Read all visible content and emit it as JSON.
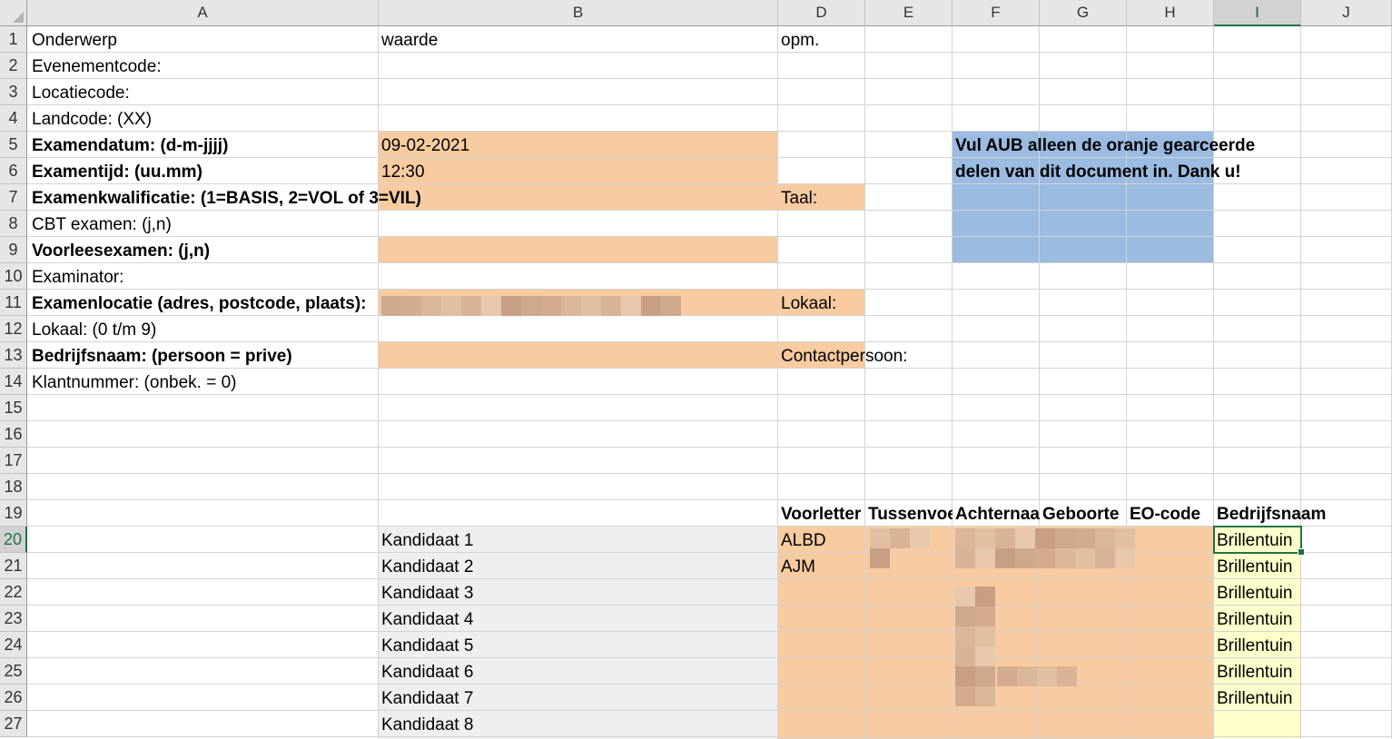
{
  "columns": [
    "A",
    "B",
    "D",
    "E",
    "F",
    "G",
    "H",
    "I",
    "J"
  ],
  "rows": [
    "1",
    "2",
    "3",
    "4",
    "5",
    "6",
    "7",
    "8",
    "9",
    "10",
    "11",
    "12",
    "13",
    "14",
    "15",
    "16",
    "17",
    "18",
    "19",
    "20",
    "21",
    "22",
    "23",
    "24",
    "25",
    "26",
    "27"
  ],
  "selected_cell": {
    "column": "I",
    "row": "20"
  },
  "colors": {
    "orange": "#f8cba0",
    "blue": "#9bbbe0",
    "grey": "#efefef",
    "yellow": "#ffffcc",
    "accent": "#217346"
  },
  "cells": {
    "A1": "Onderwerp",
    "B1": "waarde",
    "D1": "opm.",
    "A2": "Evenementcode:",
    "A3": "Locatiecode:",
    "A4": "Landcode: (XX)",
    "A5": "Examendatum: (d-m-jjjj)",
    "B5": "09-02-2021",
    "F5": "Vul AUB alleen de oranje gearceerde",
    "A6": "Examentijd: (uu.mm)",
    "B6": "12:30",
    "F6": "delen van dit document in. Dank u!",
    "A7": "Examenkwalificatie: (1=BASIS, 2=VOL of 3=VIL)",
    "D7": "Taal:",
    "A8": "CBT examen: (j,n)",
    "A9": "Voorleesexamen: (j,n)",
    "A10": "Examinator:",
    "A11": "Examenlocatie (adres, postcode, plaats):",
    "D11": "Lokaal:",
    "A12": "Lokaal: (0 t/m 9)",
    "A13": "Bedrijfsnaam: (persoon = prive)",
    "D13": "Contactpersoon:",
    "A14": "Klantnummer: (onbek. = 0)",
    "D19": "Voorletter",
    "E19": "Tussenvoe",
    "F19": "Achternaa",
    "G19": "Geboorte",
    "H19": "EO-code",
    "I19": "Bedrijfsnaam",
    "B20": "Kandidaat 1",
    "D20": "ALBD",
    "I20": "Brillentuin",
    "B21": "Kandidaat 2",
    "D21": "AJM",
    "I21": "Brillentuin",
    "B22": "Kandidaat 3",
    "I22": "Brillentuin",
    "B23": "Kandidaat 4",
    "I23": "Brillentuin",
    "B24": "Kandidaat 5",
    "I24": "Brillentuin",
    "B25": "Kandidaat 6",
    "I25": "Brillentuin",
    "B26": "Kandidaat 7",
    "I26": "Brillentuin",
    "B27": "Kandidaat 8"
  }
}
